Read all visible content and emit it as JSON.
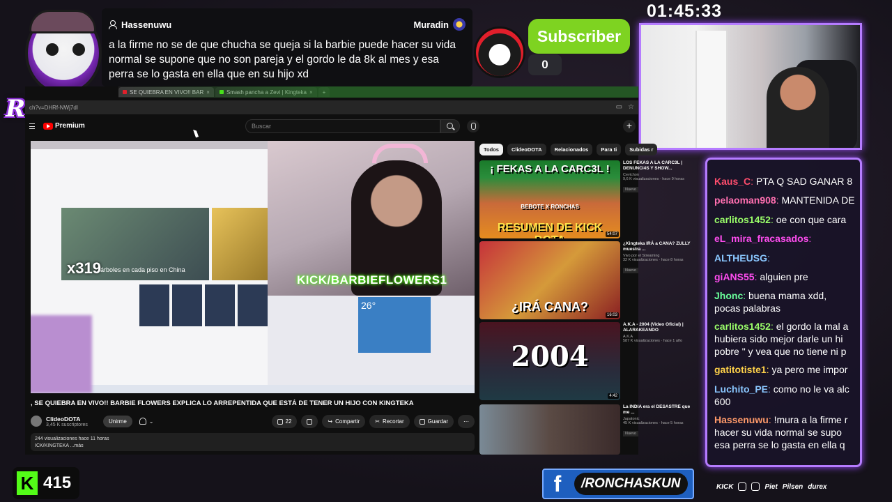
{
  "overlay": {
    "logo_text": "RONCHAS",
    "timer": "01:45:33",
    "subscriber_label": "Subscriber",
    "subscriber_count": "0",
    "kick_count": "415",
    "facebook_handle": "/RONCHASKUN",
    "sponsors": [
      "KICK",
      "Piet",
      "Pilsen",
      "durex"
    ]
  },
  "popup": {
    "username": "Hassenuwu",
    "right_user": "Muradin",
    "message": "a la firme no se de que chucha se queja si la barbie puede hacer su vida normal se supone que no son pareja y el gordo le da 8k al mes y esa perra se lo gasta en ella que en su hijo xd"
  },
  "browser": {
    "tabs": [
      {
        "label": "SE QUIEBRA EN VIVO!! BAR",
        "active": true
      },
      {
        "label": "Smash pancha a Zevi | Kingteka",
        "active": false
      }
    ],
    "url": "ch?v=DHRf-NWj7dI",
    "search_placeholder": "Buscar",
    "premium_label": "Premium",
    "video": {
      "overlay_text": "x319",
      "overlay_caption": "árboles en cada piso en China",
      "kick_tag": "KICK/BARBIEFLOWERS1",
      "title": ", SE QUIEBRA EN VIVO!! BARBIE FLOWERS EXPLICA LO ARREPENTIDA QUE ESTÁ DE TENER UN HIJO CON KINGTEKA",
      "channel": "ClideoDOTA",
      "subs": "3,45 K suscriptores",
      "unsubscribe": "Unirme",
      "likes": "22",
      "share": "Compartir",
      "clip": "Recortar",
      "save": "Guardar",
      "views_line": "244 visualizaciones  hace 11 horas",
      "desc_line": "ICK/KINGTEKA ...más"
    },
    "chips": [
      "Todos",
      "ClideoDOTA",
      "Relacionados",
      "Para ti",
      "Subidas r"
    ],
    "recommendations": [
      {
        "caption_top": "¡ FEKAS A LA CARC3L !",
        "caption_bottom": "RESUMEN DE KICK DOTA",
        "mid": "BEBOTE X RONCHAS",
        "title": "LOS FEKAS A LA CARC3L | DENUNCI4S Y SHOW...",
        "channel": "Cevichon",
        "views": "9,6 K visualizaciones · hace 9 horas",
        "badge": "Nuevo",
        "duration": "54:07"
      },
      {
        "caption_top": "",
        "caption_bottom": "¿IRÁ CANA?",
        "mid": "",
        "title": "¿Kingteka IRÁ a CANA? ZULLY muestra ...",
        "channel": "Vivo por el Streaming",
        "views": "32 K visualizaciones · hace 8 horas",
        "badge": "Nuevo",
        "duration": "16:03"
      },
      {
        "caption_top": "",
        "caption_bottom": "2004",
        "mid": "",
        "title": "A.K.A - 2004 (Video Oficial) | ALARAKEANDO",
        "channel": "A.K.A",
        "views": "587 K visualizaciones · hace 1 año",
        "badge": "",
        "duration": "4:42"
      },
      {
        "caption_top": "",
        "caption_bottom": "",
        "mid": "",
        "title": "La INDIA era el DESASTRE que me ...",
        "channel": "Japatonic",
        "views": "45 K visualizaciones · hace 5 horas",
        "badge": "Nuevo",
        "duration": ""
      }
    ]
  },
  "chat": {
    "lines": [
      {
        "user": "Kaus_C",
        "color": "#ff4d6d",
        "text": "PTA Q SAD GANAR 8"
      },
      {
        "user": "pelaoman908",
        "color": "#ff6fb0",
        "text": "MANTENIDA DE"
      },
      {
        "user": "carlitos1452",
        "color": "#9bff6a",
        "text": "oe con que cara"
      },
      {
        "user": "eL_mira_fracasados",
        "color": "#ff4df0",
        "text": ""
      },
      {
        "user": "ALTHEUSG",
        "color": "#8ac7ff",
        "text": ""
      },
      {
        "user": "giANS55",
        "color": "#ff4df0",
        "text": "alguien pre"
      },
      {
        "user": "Jhonc",
        "color": "#6aff9b",
        "text": "buena mama xdd, pocas palabras"
      },
      {
        "user": "carlitos1452",
        "color": "#9bff6a",
        "text": "el gordo la mal a hubiera sido mejor darle un hi pobre \" y vea que no tiene ni p"
      },
      {
        "user": "gatitotiste1",
        "color": "#ffd24a",
        "text": "ya pero me impor"
      },
      {
        "user": "Luchito_PE",
        "color": "#8ac7ff",
        "text": "como no le va alc 600"
      },
      {
        "user": "Hassenuwu",
        "color": "#ff9a6a",
        "text": "!mura a la firme r hacer su vida normal se supo esa perra se lo gasta en ella q"
      }
    ]
  }
}
